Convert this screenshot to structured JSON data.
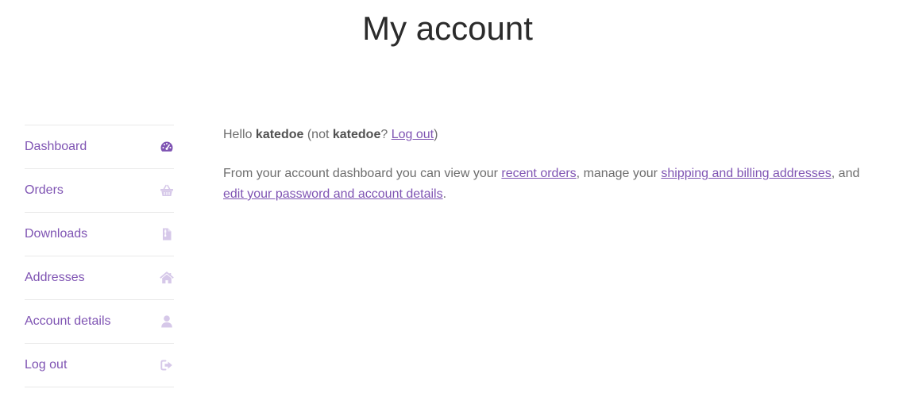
{
  "page": {
    "title": "My account"
  },
  "nav": {
    "items": [
      {
        "label": "Dashboard",
        "icon": "dashboard-icon",
        "active": true
      },
      {
        "label": "Orders",
        "icon": "basket-icon",
        "active": false
      },
      {
        "label": "Downloads",
        "icon": "file-icon",
        "active": false
      },
      {
        "label": "Addresses",
        "icon": "home-icon",
        "active": false
      },
      {
        "label": "Account details",
        "icon": "user-icon",
        "active": false
      },
      {
        "label": "Log out",
        "icon": "sign-out-icon",
        "active": false
      }
    ]
  },
  "greeting": {
    "hello": "Hello",
    "username": "katedoe",
    "not_open": "(not",
    "username_again": "katedoe",
    "question": "?",
    "logout_link": "Log out",
    "close": ")"
  },
  "intro": {
    "text1": "From your account dashboard you can view your",
    "recent_orders_link": "recent orders",
    "text2": ", manage your",
    "addresses_link": "shipping and billing addresses",
    "text3": ", and",
    "account_details_link": "edit your password and account details",
    "text4": "."
  },
  "colors": {
    "accent": "#7f54b3",
    "icon_muted": "#d6c8e9",
    "title": "#2b2b2b",
    "body": "#6d6d6d",
    "divider": "#e9e9e9"
  }
}
